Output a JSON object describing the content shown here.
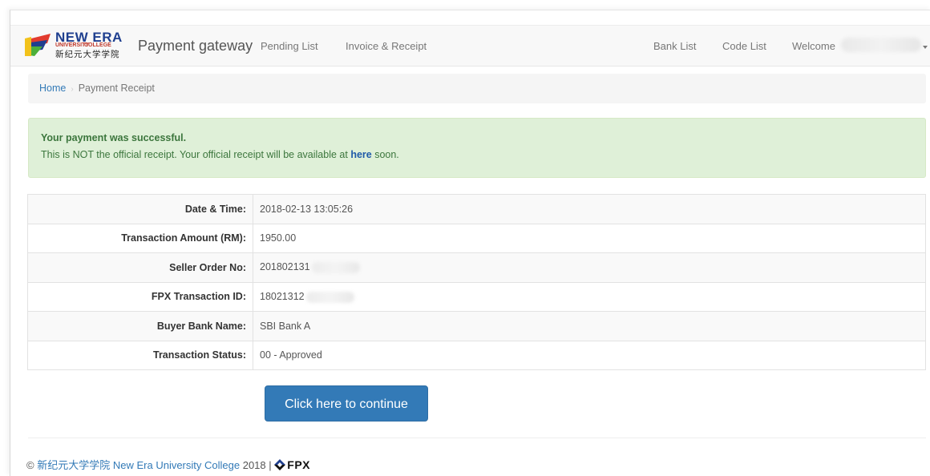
{
  "navbar": {
    "logo": {
      "en": "NEW ERA",
      "sub_university": "UNIVERSITY",
      "sub_college": "COLLEGE",
      "cn": "新纪元大学学院"
    },
    "brand": "Payment gateway",
    "left_items": [
      "Pending List",
      "Invoice & Receipt"
    ],
    "right_items": [
      "Bank List",
      "Code List"
    ],
    "welcome_label": "Welcome"
  },
  "breadcrumb": {
    "home": "Home",
    "current": "Payment Receipt"
  },
  "alert": {
    "title": "Your payment was successful.",
    "message_before": "This is NOT the official receipt. Your official receipt will be available at ",
    "link": "here",
    "message_after": " soon."
  },
  "receipt": {
    "rows": [
      {
        "label": "Date & Time:",
        "value": "2018-02-13 13:05:26"
      },
      {
        "label": "Transaction Amount (RM):",
        "value": "1950.00"
      },
      {
        "label": "Seller Order No:",
        "value": "201802131"
      },
      {
        "label": "FPX Transaction ID:",
        "value": "18021312"
      },
      {
        "label": "Buyer Bank Name:",
        "value": "SBI Bank A"
      },
      {
        "label": "Transaction Status:",
        "value": "00 - Approved"
      }
    ]
  },
  "continue_button": "Click here to continue",
  "footer": {
    "copyright": "©",
    "org_cn": "新纪元大学学院",
    "org_en": "New Era University College",
    "year": "2018 |",
    "fpx": "FPX"
  },
  "colors": {
    "primary": "#337ab7",
    "success_bg": "#dff0d8",
    "success_text": "#3c763d",
    "navbar_bg": "#f8f8f8"
  }
}
